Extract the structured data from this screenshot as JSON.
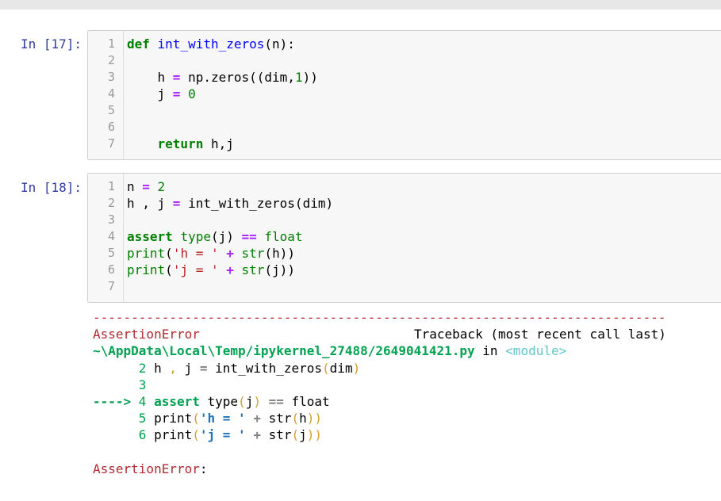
{
  "cell17": {
    "prompt": "In [17]:",
    "lines": [
      {
        "n": "1",
        "parts": [
          [
            "kw",
            "def"
          ],
          [
            "",
            ""
          ],
          [
            "fn",
            " int_with_zeros"
          ],
          [
            "",
            "(n):"
          ]
        ]
      },
      {
        "n": "2",
        "parts": []
      },
      {
        "n": "3",
        "parts": [
          [
            "",
            "    h "
          ],
          [
            "op",
            "="
          ],
          [
            "",
            " np.zeros((dim,"
          ],
          [
            "num",
            "1"
          ],
          [
            "",
            "))"
          ]
        ]
      },
      {
        "n": "4",
        "parts": [
          [
            "",
            "    j "
          ],
          [
            "op",
            "="
          ],
          [
            "",
            " "
          ],
          [
            "num",
            "0"
          ]
        ]
      },
      {
        "n": "5",
        "parts": []
      },
      {
        "n": "6",
        "parts": []
      },
      {
        "n": "7",
        "parts": [
          [
            "",
            "    "
          ],
          [
            "kw",
            "return"
          ],
          [
            "",
            " h,j"
          ]
        ]
      }
    ]
  },
  "cell18": {
    "prompt": "In [18]:",
    "lines": [
      {
        "n": "1",
        "parts": [
          [
            "",
            "n "
          ],
          [
            "op",
            "="
          ],
          [
            "",
            " "
          ],
          [
            "num",
            "2"
          ]
        ]
      },
      {
        "n": "2",
        "parts": [
          [
            "",
            "h , j "
          ],
          [
            "op",
            "="
          ],
          [
            "",
            " int_with_zeros(dim)"
          ]
        ]
      },
      {
        "n": "3",
        "parts": []
      },
      {
        "n": "4",
        "parts": [
          [
            "kw",
            "assert"
          ],
          [
            "",
            " "
          ],
          [
            "bi",
            "type"
          ],
          [
            "",
            "(j) "
          ],
          [
            "op",
            "=="
          ],
          [
            "",
            " "
          ],
          [
            "bi",
            "float"
          ]
        ]
      },
      {
        "n": "5",
        "parts": [
          [
            "bi",
            "print"
          ],
          [
            "",
            "("
          ],
          [
            "str",
            "'h = '"
          ],
          [
            "",
            " "
          ],
          [
            "op",
            "+"
          ],
          [
            "",
            " "
          ],
          [
            "bi",
            "str"
          ],
          [
            "",
            "(h))"
          ]
        ]
      },
      {
        "n": "6",
        "parts": [
          [
            "bi",
            "print"
          ],
          [
            "",
            "("
          ],
          [
            "str",
            "'j = '"
          ],
          [
            "",
            " "
          ],
          [
            "op",
            "+"
          ],
          [
            "",
            " "
          ],
          [
            "bi",
            "str"
          ],
          [
            "",
            "(j))"
          ]
        ]
      },
      {
        "n": "7",
        "parts": []
      }
    ]
  },
  "output": {
    "separator": "---------------------------------------------------------------------------",
    "error_name": "AssertionError",
    "traceback_label": "Traceback (most recent call last)",
    "file_path": "~\\AppData\\Local\\Temp/ipykernel_27488/2649041421.py",
    "in_word": " in ",
    "module": "<module>",
    "trace_lines": [
      {
        "prefix": "      ",
        "n": "2",
        "parts": [
          [
            "",
            " h "
          ],
          [
            "tpar",
            ","
          ],
          [
            "",
            " j "
          ],
          [
            "top",
            "="
          ],
          [
            "",
            " int_with_zeros"
          ],
          [
            "tpar",
            "("
          ],
          [
            "",
            "dim"
          ],
          [
            "tpar",
            ")"
          ]
        ]
      },
      {
        "prefix": "      ",
        "n": "3",
        "parts": []
      },
      {
        "prefix": "----> ",
        "n": "4",
        "parts": [
          [
            "tkw",
            " assert"
          ],
          [
            "",
            " type"
          ],
          [
            "tpar",
            "("
          ],
          [
            "",
            "j"
          ],
          [
            "tpar",
            ")"
          ],
          [
            "",
            " "
          ],
          [
            "top",
            "=="
          ],
          [
            "",
            " float"
          ]
        ]
      },
      {
        "prefix": "      ",
        "n": "5",
        "parts": [
          [
            "",
            " print"
          ],
          [
            "tpar",
            "("
          ],
          [
            "tstr",
            "'h = '"
          ],
          [
            "",
            " "
          ],
          [
            "top",
            "+"
          ],
          [
            "",
            " str"
          ],
          [
            "tpar",
            "("
          ],
          [
            "",
            "h"
          ],
          [
            "tpar",
            "))"
          ]
        ]
      },
      {
        "prefix": "      ",
        "n": "6",
        "parts": [
          [
            "",
            " print"
          ],
          [
            "tpar",
            "("
          ],
          [
            "tstr",
            "'j = '"
          ],
          [
            "",
            " "
          ],
          [
            "top",
            "+"
          ],
          [
            "",
            " str"
          ],
          [
            "tpar",
            "("
          ],
          [
            "",
            "j"
          ],
          [
            "tpar",
            "))"
          ]
        ]
      }
    ],
    "final_error": "AssertionError",
    "final_colon": ":"
  }
}
